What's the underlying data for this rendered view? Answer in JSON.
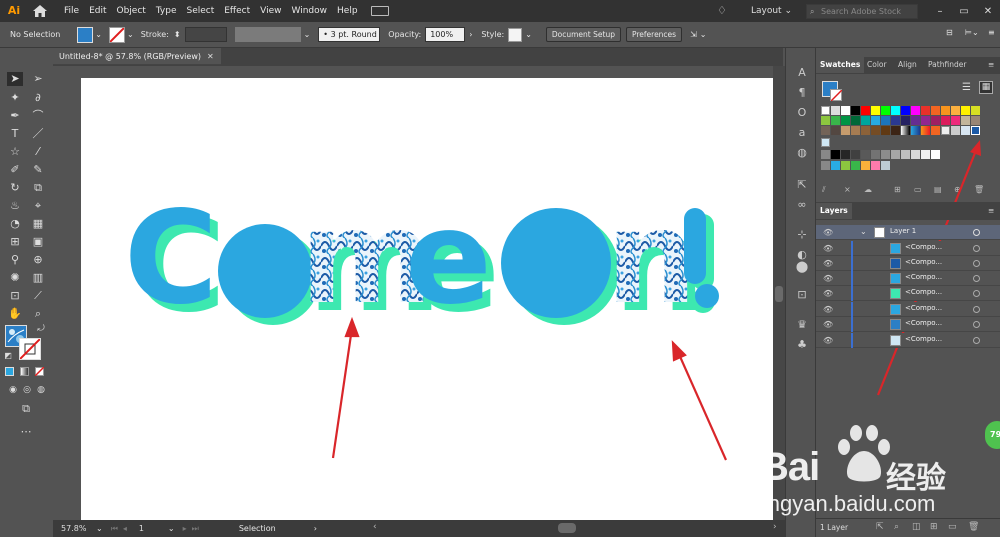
{
  "app": {
    "logo": "Ai"
  },
  "menu": [
    "File",
    "Edit",
    "Object",
    "Type",
    "Select",
    "Effect",
    "View",
    "Window",
    "Help"
  ],
  "topright": {
    "layout_label": "Layout",
    "search_placeholder": "Search Adobe Stock"
  },
  "control_bar": {
    "selection_label": "No Selection",
    "stroke_label": "Stroke:",
    "stroke_profile": "3 pt. Round",
    "opacity_label": "Opacity:",
    "opacity_value": "100%",
    "style_label": "Style:",
    "document_setup": "Document Setup",
    "preferences": "Preferences"
  },
  "document": {
    "tab_title": "Untitled-8* @ 57.8% (RGB/Preview)"
  },
  "artwork": {
    "text": "Come On!",
    "fill_color": "#2ba7e0",
    "shadow_color": "#3de8b0"
  },
  "status_bar": {
    "zoom": "57.8%",
    "artboard": "1",
    "mode": "Selection"
  },
  "swatches_panel": {
    "tabs": [
      "Swatches",
      "Color",
      "Align",
      "Pathfinder"
    ]
  },
  "layers_panel": {
    "title": "Layers",
    "layer_name": "Layer 1",
    "sublayers": [
      "<Compo...",
      "<Compo...",
      "<Compo...",
      "<Compo...",
      "<Compo...",
      "<Compo...",
      "<Compo..."
    ],
    "footer": "1 Layer"
  },
  "watermark": {
    "brand": "Bai",
    "cn": "经验",
    "url": "jingyan.baidu.com"
  },
  "badge": "79"
}
